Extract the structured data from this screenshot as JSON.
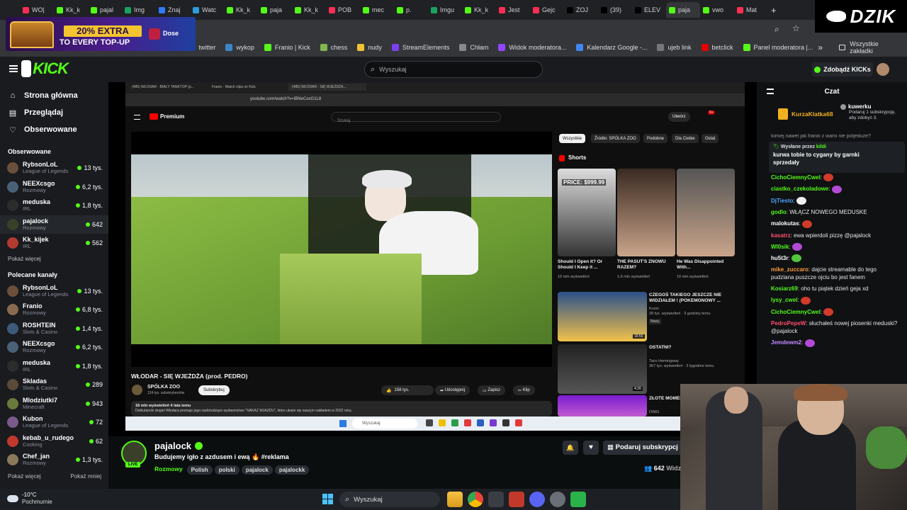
{
  "browser": {
    "tabs": [
      {
        "label": "WO|",
        "color": "#ff2d55"
      },
      {
        "label": "Kk_k",
        "color": "#53fc18"
      },
      {
        "label": "pajal",
        "color": "#53fc18"
      },
      {
        "label": "Img",
        "color": "#1aa260"
      },
      {
        "label": "Znaj",
        "color": "#2d7cf6"
      },
      {
        "label": "Watc",
        "color": "#2d9cdb"
      },
      {
        "label": "Kk_k",
        "color": "#53fc18"
      },
      {
        "label": "paja",
        "color": "#53fc18"
      },
      {
        "label": "Kk_k",
        "color": "#53fc18"
      },
      {
        "label": "POB",
        "color": "#ff2d55"
      },
      {
        "label": "mec",
        "color": "#53fc18"
      },
      {
        "label": "p.",
        "color": "#53fc18"
      },
      {
        "label": "Imgu",
        "color": "#1aa260"
      },
      {
        "label": "Kk_k",
        "color": "#53fc18"
      },
      {
        "label": "Jest",
        "color": "#ff2d55"
      },
      {
        "label": "Gejc",
        "color": "#ff2d55"
      },
      {
        "label": "ZOJ",
        "color": "#000000"
      },
      {
        "label": "(39)",
        "color": "#000000"
      },
      {
        "label": "ELEV",
        "color": "#000000"
      },
      {
        "label": "paja",
        "color": "#53fc18"
      },
      {
        "label": "vwo",
        "color": "#53fc18"
      },
      {
        "label": "Mat",
        "color": "#ff2d55"
      }
    ],
    "new_tab": "+",
    "bookmarks": [
      {
        "label": "twitter",
        "color": "#111111"
      },
      {
        "label": "wykop",
        "color": "#3b86c8"
      },
      {
        "label": "Franio | Kick",
        "color": "#53fc18"
      },
      {
        "label": "chess",
        "color": "#81b64c"
      },
      {
        "label": "nudy",
        "color": "#f1c232"
      },
      {
        "label": "StreamElements",
        "color": "#7b3ff2"
      },
      {
        "label": "Chłam",
        "color": "#888888"
      },
      {
        "label": "Widok moderatora...",
        "color": "#9146ff"
      },
      {
        "label": "Kalendarz Google -...",
        "color": "#4285f4"
      },
      {
        "label": "ujeb link",
        "color": "#777777"
      },
      {
        "label": "betclick",
        "color": "#e60000"
      },
      {
        "label": "Panel moderatora |...",
        "color": "#53fc18"
      }
    ],
    "all_bookmarks": "Wszystkie zakładki"
  },
  "ad": {
    "headline": "20% EXTRA",
    "subline": "TO EVERY TOP-UP",
    "brand": "Dose"
  },
  "overlay_brand": "DZIK",
  "kick": {
    "logo": "KICK",
    "search_placeholder": "Wyszukaj",
    "kicks_button": "Zdobądź KICKs",
    "nav": [
      {
        "label": "Strona główna",
        "icon": "home-icon"
      },
      {
        "label": "Przeglądaj",
        "icon": "browse-icon"
      },
      {
        "label": "Obserwowane",
        "icon": "heart-icon"
      }
    ],
    "followed_title": "Obserwowane",
    "followed": [
      {
        "name": "RybsonLoL",
        "cat": "League of Legends",
        "viewers": "13 tys.",
        "color": "#6b4f3a"
      },
      {
        "name": "NEEXcsgo",
        "cat": "Rozmowy",
        "viewers": "6,2 tys.",
        "color": "#4a6078"
      },
      {
        "name": "meduska",
        "cat": "IRL",
        "viewers": "1,8 tys.",
        "color": "#2c2c2c"
      },
      {
        "name": "pajalock",
        "cat": "Rozmowy",
        "viewers": "642",
        "color": "#3a3f2a"
      },
      {
        "name": "Kk_kijek",
        "cat": "IRL",
        "viewers": "562",
        "color": "#b33a2e"
      }
    ],
    "show_more": "Pokaż więcej",
    "recommended_title": "Polecane kanały",
    "recommended": [
      {
        "name": "RybsonLoL",
        "cat": "League of Legends",
        "viewers": "13 tys.",
        "color": "#6b4f3a"
      },
      {
        "name": "Franio",
        "cat": "Rozmowy",
        "viewers": "6,8 tys.",
        "color": "#8a6a4e"
      },
      {
        "name": "ROSHTEIN",
        "cat": "Slots & Casino",
        "viewers": "1,4 tys.",
        "color": "#3d5a7a"
      },
      {
        "name": "NEEXcsgo",
        "cat": "Rozmowy",
        "viewers": "6,2 tys.",
        "color": "#4a6078"
      },
      {
        "name": "meduska",
        "cat": "IRL",
        "viewers": "1,8 tys.",
        "color": "#2c2c2c"
      },
      {
        "name": "Skladas",
        "cat": "Slots & Casino",
        "viewers": "289",
        "color": "#5a4a3a"
      },
      {
        "name": "Mlodziutki7",
        "cat": "Minecraft",
        "viewers": "943",
        "color": "#6a7a3a"
      },
      {
        "name": "Kubon",
        "cat": "League of Legends",
        "viewers": "72",
        "color": "#7a5a8a"
      },
      {
        "name": "kebab_u_rudego",
        "cat": "Cooking",
        "viewers": "62",
        "color": "#c0392b"
      },
      {
        "name": "Chef_jan",
        "cat": "Rozmowy",
        "viewers": "1,3 tys.",
        "color": "#8a7a5a"
      }
    ],
    "show_more2": "Pokaż więcej",
    "show_less": "Pokaż mniej",
    "channel": {
      "name": "pajalock",
      "live_badge": "LIVE",
      "title": "Budujemy igło z azdusem i ewą 🔥 #reklama",
      "category": "Rozmowy",
      "tags": [
        "Polish",
        "polski",
        "pajalock",
        "pajalockk"
      ],
      "gift_button": "Podaruj subskrypcj",
      "viewers": "642",
      "viewers_suffix": "Widz"
    },
    "chat": {
      "title": "Czat",
      "top_gifter": {
        "name": "KurzaKlatka68",
        "count": "1"
      },
      "gift_notice": {
        "name": "kuwerku",
        "text": "Podaruj 1 subskrypcję, aby zdobyć 3."
      },
      "cut_line": "tomiej nawet jak franio z wami nie potjeduze?",
      "pinned": {
        "label": "Wysłane przez",
        "by": "kildi",
        "text": "kurwa tobie to cygany by garnki sprzedały"
      },
      "messages": [
        {
          "user": "CichoCiemnyCwel",
          "text": "",
          "color": "#53fc18",
          "emote": "#d23b2a"
        },
        {
          "user": "ciastko_czekoladowe",
          "text": "",
          "color": "#53fc18",
          "emote": "#b24ad6"
        },
        {
          "user": "DjTiesto",
          "text": "",
          "color": "#4fa3ff",
          "emote": "#f0f0f0"
        },
        {
          "user": "godlo",
          "text": "WŁĄCZ NOWEGO MEDUSKE",
          "color": "#53fc18",
          "emote": ""
        },
        {
          "user": "malokutas",
          "text": "",
          "color": "#ffffff",
          "emote": "#d23b2a"
        },
        {
          "user": "kasatrz",
          "text": "ewa wpierdoli pizzę @pajalock",
          "color": "#ff4d6d",
          "emote": ""
        },
        {
          "user": "Wl0sik",
          "text": "",
          "color": "#53fc18",
          "emote": "#b24ad6"
        },
        {
          "user": "hu5t3r",
          "text": "",
          "color": "#ffffff",
          "emote": "#53c43a"
        },
        {
          "user": "mike_zuccaro",
          "text": "dajcie streamable do tego pudziana puszcze ojciu bo jest fanem",
          "color": "#ff9a3c",
          "emote": ""
        },
        {
          "user": "Kosiarz69",
          "text": "oho tu piątek dzień geja xd",
          "color": "#53fc18",
          "emote": ""
        },
        {
          "user": "lysy_cwel",
          "text": "",
          "color": "#53fc18",
          "emote": "#d23b2a"
        },
        {
          "user": "CichoCiemnyCwel",
          "text": "",
          "color": "#53fc18",
          "emote": "#d23b2a"
        },
        {
          "user": "PedroPepeW",
          "text": "słuchałeś nowej piosenki meduski? @pajalock",
          "color": "#ff4d6d",
          "emote": ""
        },
        {
          "user": "Jemdewm2",
          "text": "",
          "color": "#c58aff",
          "emote": "#b24ad6"
        }
      ]
    }
  },
  "youtube": {
    "tabs": [
      "(485) WŁODAR - BIAŁY TANKTOP (p...",
      "Franio - Watch clips on Kick",
      "(485) WŁODAR - SIĘ WJEŻDŻA..."
    ],
    "url": "youtube.com/watch?v=IBNeCoxG1L8",
    "logo": "Premium",
    "search_placeholder": "Szukaj",
    "create": "Utwórz",
    "notif_count": "9+",
    "video_title": "WŁODAR - SIĘ WJEŻDŻA (prod. PEDRO)",
    "channel": "SPÓLKA ZOO",
    "subs": "124 tys. subskrybentów",
    "subscribe": "Subskrybuj",
    "likes": "158 tys.",
    "share": "Udostępnij",
    "save": "Zapisz",
    "clip": "Klip",
    "desc": "18 mln wyświetleń  4 lata temu",
    "desc2": "Debiutancki singiel Włodara promuje jego nadchodzące wydawnictwo \"NAKAZ WJAZDU\", które ukaże się naszym nakładem w 2022 roku.",
    "chips": [
      "Wszystkie",
      "Źródło: SPÓLKA ZOO",
      "Podobne",
      "Dla Ciebie",
      "Ostat"
    ],
    "shorts_title": "Shorts",
    "shorts": [
      {
        "title": "Should I Open it? Or Should I Keep it ...",
        "views": "10 mln wyświetleń",
        "overlay": "PRICE: $999.99"
      },
      {
        "title": "THE PASUT'S ZNOWU RAZEM?",
        "views": "1,6 mln wyświetleń",
        "overlay": ""
      },
      {
        "title": "He Was Disappointed With...",
        "views": "10 mln wyświetleń",
        "overlay": ""
      }
    ],
    "recs": [
      {
        "title": "CZEGOŚ TAKIEGO JESZCZE NIE WIDZIAŁEM ! (POKEMONOWY ...",
        "channel": "Kozio",
        "views": "28 tys. wyświetleń · 3 godziny temu",
        "badge": "Nowy",
        "dur": "16:50"
      },
      {
        "title": "OSTATNI?",
        "channel": "Taco Hemingway",
        "views": "367 tys. wyświetleń · 3 tygodnie temu",
        "badge": "",
        "dur": "4:20"
      },
      {
        "title": "ZŁOTE MOMENTY",
        "channel": "DIMO",
        "views": "",
        "badge": "",
        "dur": ""
      }
    ],
    "win_search": "Wyszukaj"
  },
  "taskbar": {
    "weather_temp": "-10°C",
    "weather_desc": "Pochmurnie",
    "search": "Wyszukaj",
    "icons": [
      "explorer-icon",
      "chrome-icon",
      "app-icon",
      "app2-icon",
      "discord-icon",
      "settings-icon",
      "notes-icon"
    ]
  }
}
